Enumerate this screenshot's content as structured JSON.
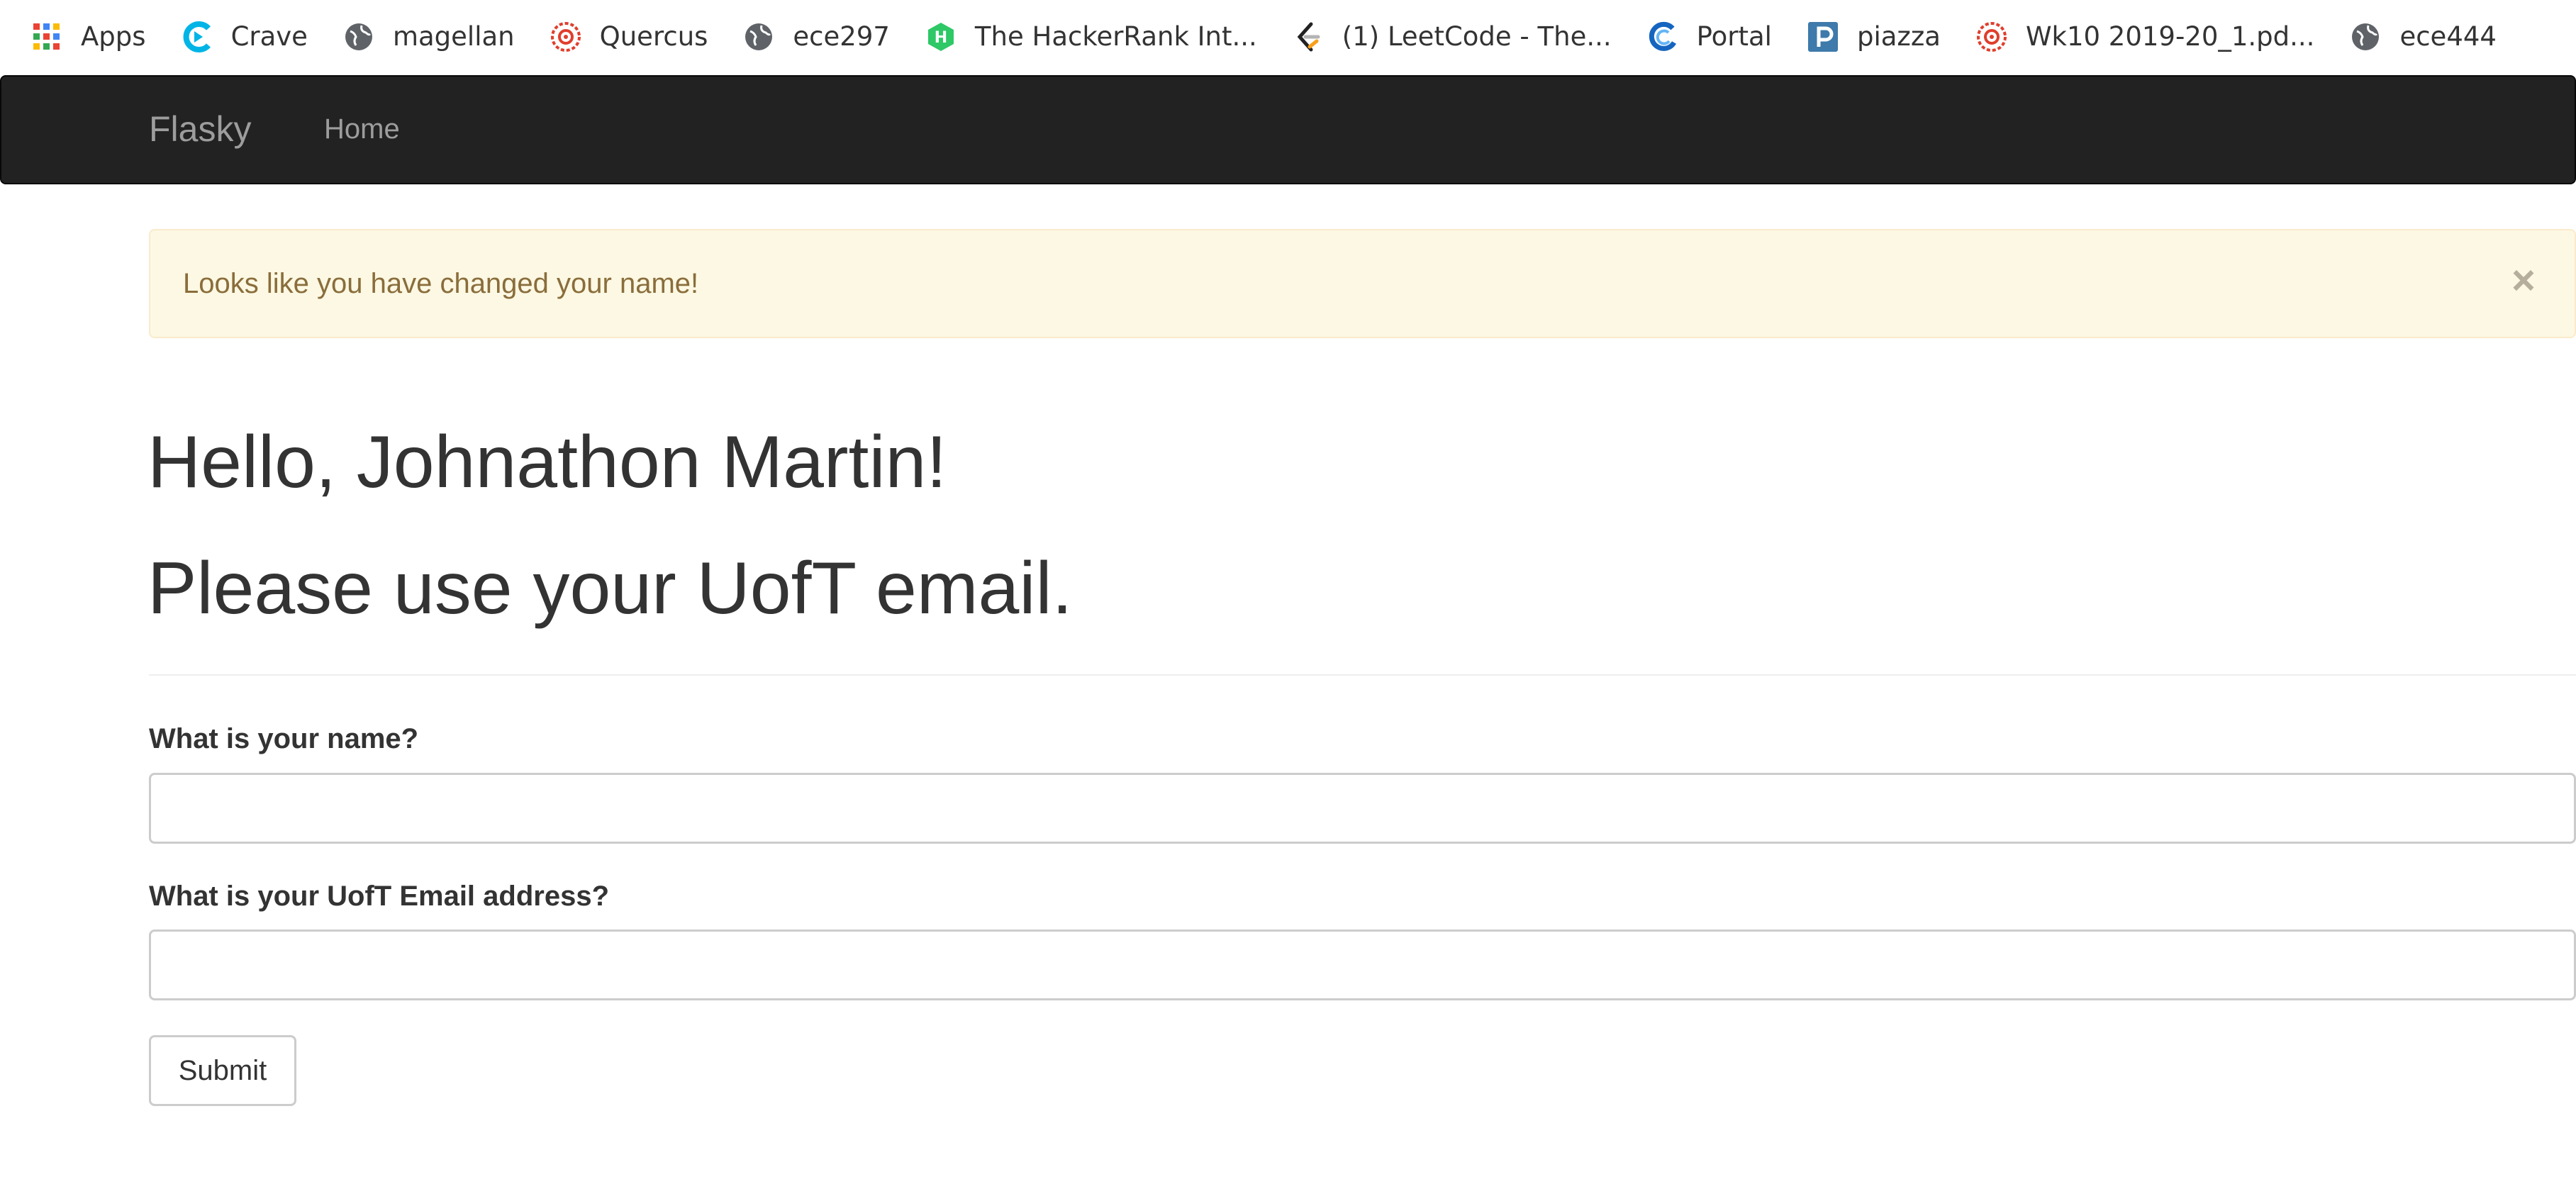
{
  "bookmarks": [
    {
      "label": "Apps",
      "icon": "apps-grid-icon"
    },
    {
      "label": "Crave",
      "icon": "crave-icon"
    },
    {
      "label": "magellan",
      "icon": "globe-icon"
    },
    {
      "label": "Quercus",
      "icon": "quercus-icon"
    },
    {
      "label": "ece297",
      "icon": "globe-icon"
    },
    {
      "label": "The HackerRank Int...",
      "icon": "hackerrank-icon"
    },
    {
      "label": "(1) LeetCode - The...",
      "icon": "leetcode-icon"
    },
    {
      "label": "Portal",
      "icon": "portal-icon"
    },
    {
      "label": "piazza",
      "icon": "piazza-icon"
    },
    {
      "label": "Wk10 2019-20_1.pd...",
      "icon": "quercus-icon"
    },
    {
      "label": "ece444",
      "icon": "globe-icon"
    }
  ],
  "navbar": {
    "brand": "Flasky",
    "home": "Home"
  },
  "alert": {
    "message": "Looks like you have changed your name!",
    "close": "×"
  },
  "headings": {
    "greeting": "Hello, Johnathon Martin!",
    "notice": "Please use your UofT email."
  },
  "form": {
    "name_label": "What is your name?",
    "name_value": "",
    "email_label": "What is your UofT Email address?",
    "email_value": "",
    "submit_label": "Submit"
  },
  "colors": {
    "navbar_bg": "#222222",
    "alert_bg": "#fcf8e3",
    "alert_text": "#8a6d3b"
  }
}
